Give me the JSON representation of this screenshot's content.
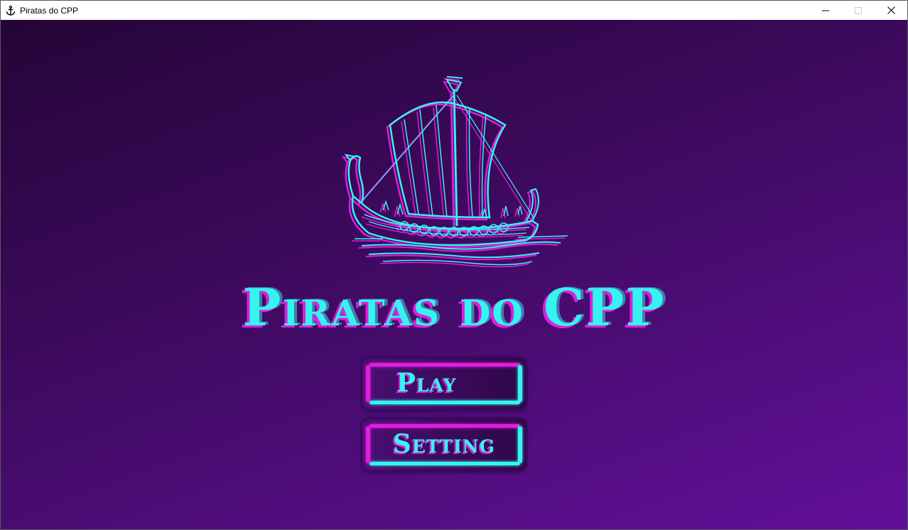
{
  "window": {
    "title": "Piratas do CPP",
    "icon": "anchor-icon",
    "controls": [
      "minimize-icon",
      "maximize-icon",
      "close-icon"
    ]
  },
  "game": {
    "title": "Piratas do CPP",
    "logo": "viking-ship-icon",
    "menu": {
      "play_label": "Play",
      "setting_label": "Setting"
    }
  },
  "colors": {
    "background_top": "#240537",
    "background_bottom": "#620f99",
    "accent_cyan": "#35f4f0",
    "accent_magenta": "#e21ce0"
  }
}
